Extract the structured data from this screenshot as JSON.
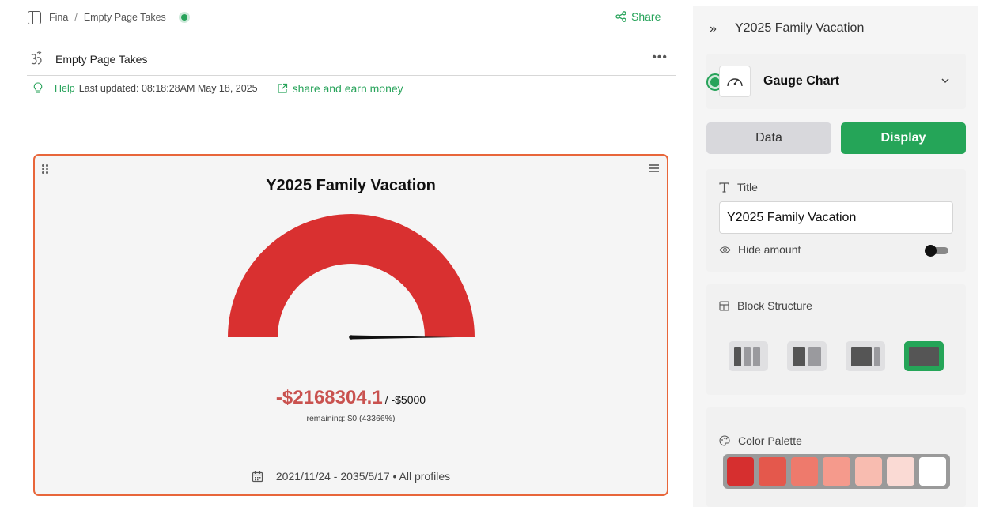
{
  "breadcrumb": {
    "workspace": "Fina",
    "separator": "/",
    "page": "Empty Page Takes"
  },
  "topbar": {
    "share_label": "Share"
  },
  "page": {
    "title": "Empty Page Takes",
    "more_label": "•••",
    "help_label": "Help",
    "last_updated": "Last updated: 08:18:28AM May 18, 2025",
    "earn_label": "share and earn money"
  },
  "card": {
    "title": "Y2025 Family Vacation",
    "amount": "-$2168304.1",
    "target": "/ -$5000",
    "remaining": "remaining: $0 (43366%)",
    "footer": "2021/11/24 - 2035/5/17 • All profiles"
  },
  "gauge_data": {
    "value": -2168304.1,
    "target": -5000,
    "fill_color": "#d93030",
    "needle_position": 1.0
  },
  "panel": {
    "title": "Y2025 Family Vacation",
    "widget_type": "Gauge Chart",
    "tab_data": "Data",
    "tab_display": "Display",
    "title_section_label": "Title",
    "title_value": "Y2025 Family Vacation",
    "hide_amount_label": "Hide amount",
    "hide_amount_on": false,
    "block_structure_label": "Block Structure",
    "color_palette_label": "Color Palette",
    "palette": [
      "#d62f2f",
      "#e4584c",
      "#ee7a6c",
      "#f59a8c",
      "#f8bcb0",
      "#fadad4",
      "#ffffff"
    ]
  },
  "colors": {
    "accent": "#27a35a",
    "card_border": "#e8663a",
    "amount_text": "#c9524f"
  }
}
